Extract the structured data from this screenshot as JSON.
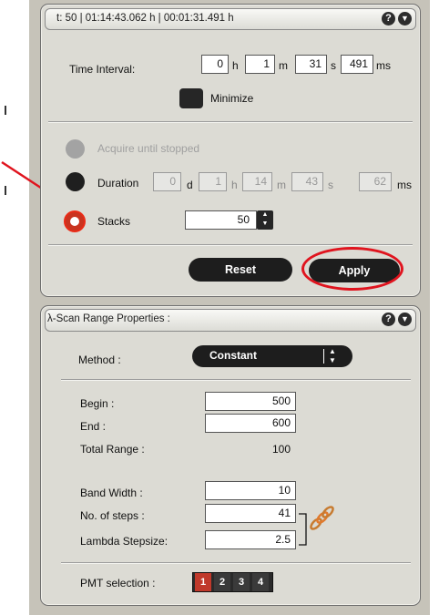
{
  "top_panel": {
    "header": "t:   50  |  01:14:43.062 h  |  00:01:31.491 h",
    "time_interval": {
      "label": "Time Interval:",
      "hours": "0",
      "hours_unit": "h",
      "minutes": "1",
      "minutes_unit": "m",
      "seconds": "31",
      "seconds_unit": "s",
      "milliseconds": "491",
      "milliseconds_unit": "ms"
    },
    "minimize_label": "Minimize",
    "acquire_label": "Acquire until stopped",
    "duration": {
      "label": "Duration",
      "days": "0",
      "days_unit": "d",
      "hours": "1",
      "hours_unit": "h",
      "minutes": "14",
      "minutes_unit": "m",
      "seconds": "43",
      "seconds_unit": "s",
      "milliseconds": "62",
      "milliseconds_unit": "ms"
    },
    "stacks": {
      "label": "Stacks",
      "value": "50"
    },
    "reset_label": "Reset",
    "apply_label": "Apply"
  },
  "bottom_panel": {
    "header": "λ-Scan Range Properties :",
    "method": {
      "label": "Method :",
      "value": "Constant"
    },
    "begin": {
      "label": "Begin :",
      "value": "500"
    },
    "end": {
      "label": "End :",
      "value": "600"
    },
    "total_range": {
      "label": "Total Range :",
      "value": "100"
    },
    "band_width": {
      "label": "Band Width :",
      "value": "10"
    },
    "num_steps": {
      "label": "No. of steps :",
      "value": "41"
    },
    "lambda_stepsize": {
      "label": "Lambda Stepsize:",
      "value": "2.5"
    },
    "pmt": {
      "label": "PMT selection :",
      "options": [
        "1",
        "2",
        "3",
        "4"
      ],
      "selected": "1"
    }
  },
  "colors": {
    "annotation_red": "#e0141e",
    "panel_bg": "#dcdbd4",
    "pmt_selected": "#c0392b",
    "pmt_unselected": "#3a3a3a"
  },
  "icons": [
    "help-icon",
    "collapse-icon",
    "up-down-arrow-icon",
    "link-chain-icon",
    "annotation-arrow"
  ]
}
